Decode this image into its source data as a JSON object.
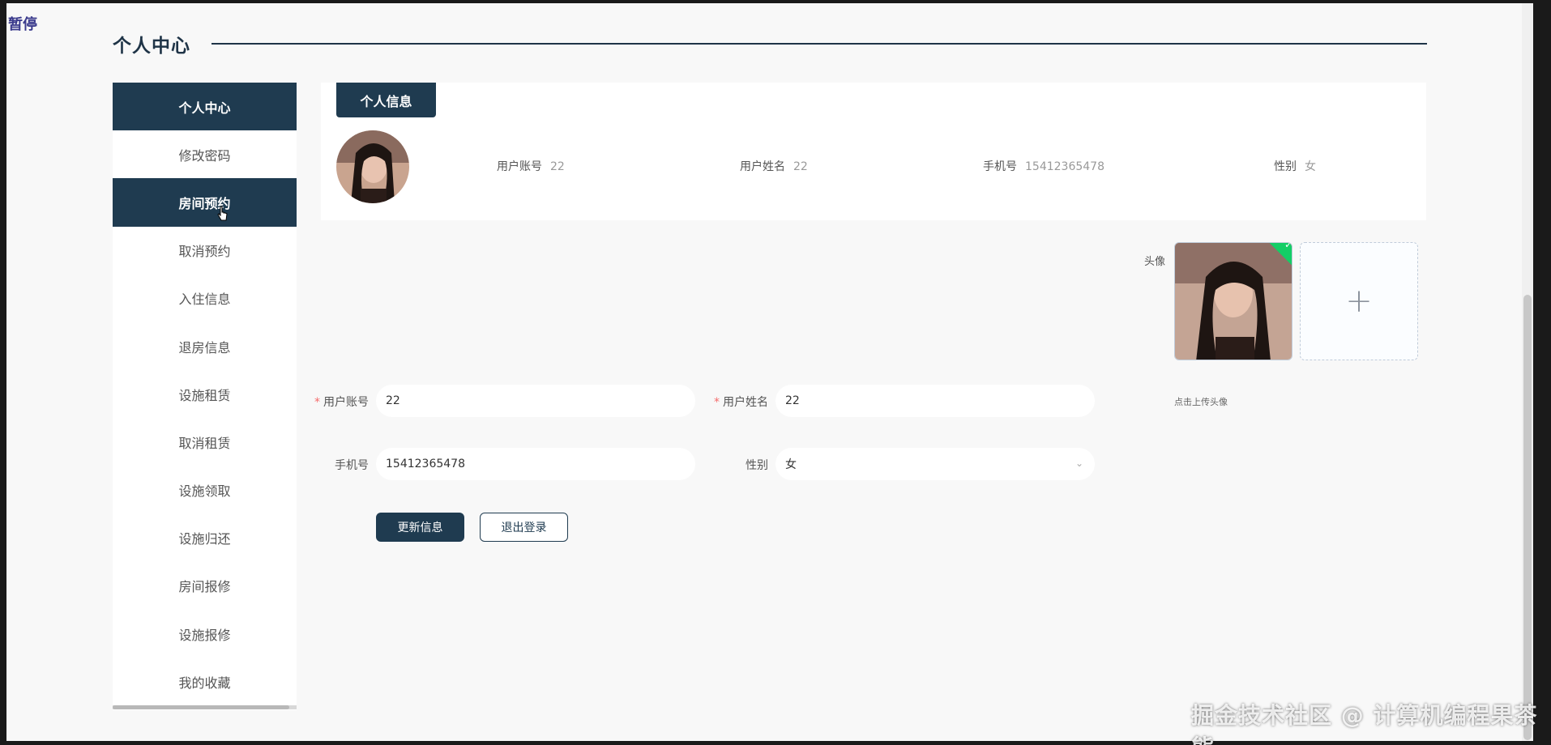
{
  "overlay": {
    "pause_label": "暂停",
    "watermark": "掘金技术社区 @ 计算机编程果茶熊"
  },
  "header": {
    "title": "个人中心"
  },
  "sidebar": {
    "items": [
      {
        "label": "个人中心"
      },
      {
        "label": "修改密码"
      },
      {
        "label": "房间预约"
      },
      {
        "label": "取消预约"
      },
      {
        "label": "入住信息"
      },
      {
        "label": "退房信息"
      },
      {
        "label": "设施租赁"
      },
      {
        "label": "取消租赁"
      },
      {
        "label": "设施领取"
      },
      {
        "label": "设施归还"
      },
      {
        "label": "房间报修"
      },
      {
        "label": "设施报修"
      },
      {
        "label": "我的收藏"
      }
    ]
  },
  "info_card": {
    "tab_label": "个人信息",
    "account_label": "用户账号",
    "account_value": "22",
    "name_label": "用户姓名",
    "name_value": "22",
    "phone_label": "手机号",
    "phone_value": "15412365478",
    "gender_label": "性别",
    "gender_value": "女"
  },
  "form": {
    "avatar_label": "头像",
    "upload_plus": "+",
    "upload_hint": "点击上传头像",
    "required_mark": "*",
    "account_label": "用户账号",
    "account_value": "22",
    "name_label": "用户姓名",
    "name_value": "22",
    "phone_label": "手机号",
    "phone_value": "15412365478",
    "gender_label": "性别",
    "gender_value": "女",
    "update_button": "更新信息",
    "logout_button": "退出登录"
  },
  "colors": {
    "primary": "#1f3b50",
    "required": "#f56c6c",
    "success": "#13ce66"
  }
}
